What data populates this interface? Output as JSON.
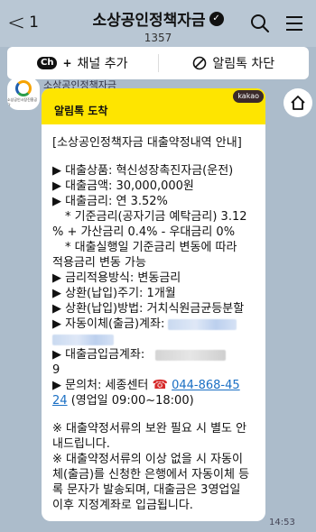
{
  "header": {
    "back_count": "1",
    "title": "소상공인정책자금",
    "member_count": "1357"
  },
  "actions": {
    "add_channel_badge": "Ch",
    "add_channel": "채널 추가",
    "block_alerts": "알림톡 차단"
  },
  "sender": {
    "name": "소상공인정책자금",
    "avatar_text": "소상공인시장진흥공단"
  },
  "message": {
    "badge": "kakao",
    "heading": "알림톡 도착",
    "title": "[소상공인정책자금 대출약정내역 안내]",
    "product": "▶ 대출상품: 혁신성장촉진자금(운전)",
    "amount": "▶ 대출금액: 30,000,000원",
    "rate": "▶ 대출금리: 연 3.52%",
    "rate_detail_1": "* 기준금리(공자기금 예탁금리) 3.12",
    "rate_detail_2": "% + 가산금리 0.4% - 우대금리 0%",
    "rate_note_1": "* 대출실행일 기준금리 변동에 따라",
    "rate_note_2": "적용금리 변동 가능",
    "rate_method": "▶ 금리적용방식: 변동금리",
    "repay_cycle": "▶ 상환(납입)주기: 1개월",
    "repay_method": "▶ 상환(납입)방법: 거치식원금균등분할",
    "auto_debit_label": "▶ 자동이체(출금)계좌:",
    "deposit_label": "▶ 대출금입금계좌:",
    "deposit_tail": "9",
    "contact_label": "▶ 문의처: 세종센터",
    "phone_part1": "044-868-45",
    "phone_part2": "24",
    "hours": "(영업일 09:00~18:00)",
    "notice1_l1": "※ 대출약정서류의 보완 필요 시 별도 안",
    "notice1_l2": "내드립니다.",
    "notice2_l1": "※ 대출약정서류의 이상 없을 시 자동이",
    "notice2_l2": "체(출금)를 신청한 은행에서 자동이체 등",
    "notice2_l3": "록 문자가 발송되며, 대출금은 3영업일",
    "notice2_l4": "이후 지정계좌로 입금됩니다."
  },
  "time": "14:53",
  "colors": {
    "chat_background": "#acbccb",
    "bubble_header": "#fee500",
    "link": "#1a6fc4"
  },
  "icons": [
    "chevron-left-icon",
    "verified-icon",
    "search-icon",
    "menu-icon",
    "block-icon",
    "phone-icon",
    "home-icon"
  ]
}
